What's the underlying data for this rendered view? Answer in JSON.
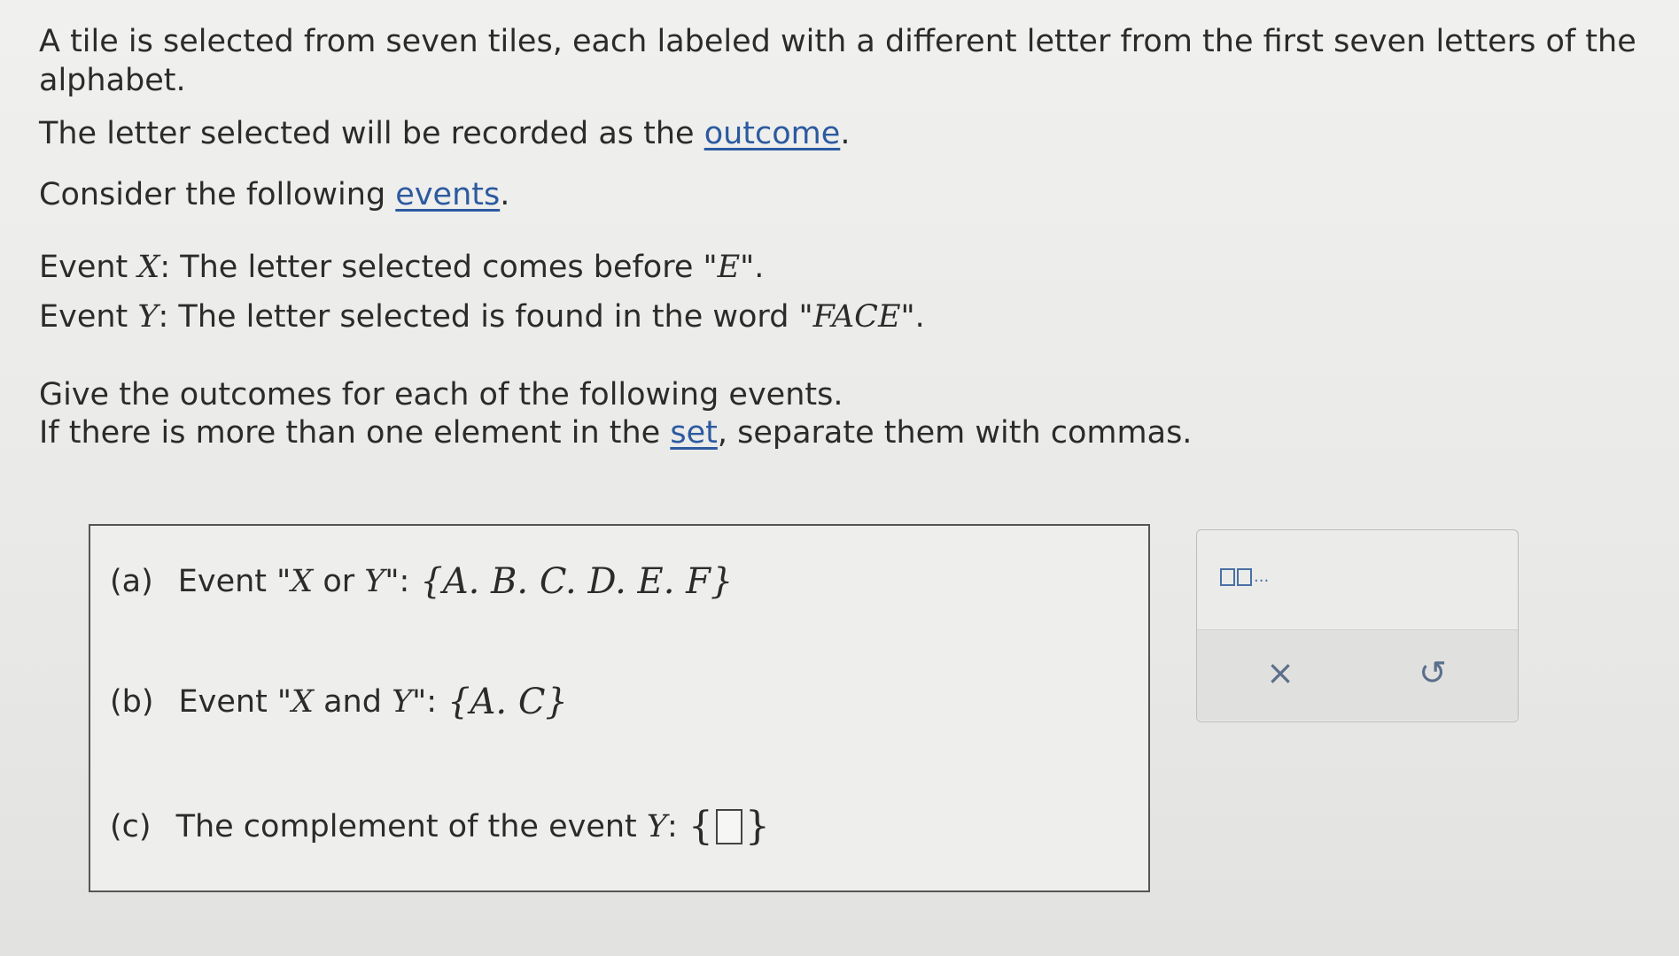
{
  "prompt": {
    "line1": "A tile is selected from seven tiles, each labeled with a different letter from the first seven letters of the alphabet.",
    "line2_before": "The letter selected will be recorded as the ",
    "line2_link": "outcome",
    "line2_after": ".",
    "line3_before": "Consider the following ",
    "line3_link": "events",
    "line3_after": ".",
    "eventX_label": "Event ",
    "eventX_var": "X",
    "eventX_text": ": The letter selected comes before \"",
    "eventX_letter": "E",
    "eventX_end": "\".",
    "eventY_label": "Event ",
    "eventY_var": "Y",
    "eventY_text": ": The letter selected is found in the word \"",
    "eventY_word": "FACE",
    "eventY_end": "\".",
    "instruction1": "Give the outcomes for each of the following events.",
    "instruction2_before": "If there is more than one element in the ",
    "instruction2_link": "set",
    "instruction2_after": ", separate them with commas."
  },
  "parts": {
    "a": {
      "letter": "(a)",
      "label_before": "Event \"",
      "var1": "X",
      "connector": " or ",
      "var2": "Y",
      "label_after": "\":",
      "answer": "{A. B. C. D. E. F}"
    },
    "b": {
      "letter": "(b)",
      "label_before": "Event \"",
      "var1": "X",
      "connector": " and ",
      "var2": "Y",
      "label_after": "\":",
      "answer": "{A. C}"
    },
    "c": {
      "letter": "(c)",
      "label_before": "The complement of the event ",
      "var1": "Y",
      "label_after": ":",
      "brace_open": "{",
      "brace_close": "}"
    }
  },
  "toolbox": {
    "set_tool_ellipsis": "...",
    "clear_symbol": "×",
    "undo_symbol": "↺"
  },
  "colors": {
    "link": "#2c5aa0",
    "tool_icon": "#5a6f8a"
  }
}
